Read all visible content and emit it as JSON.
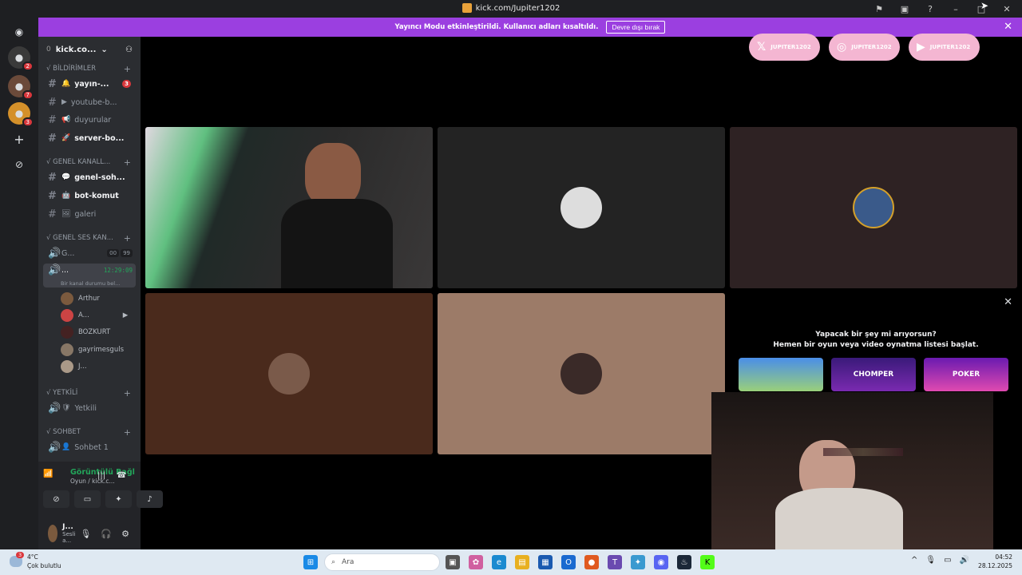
{
  "window": {
    "url_title": "kick.com/Jupiter1202"
  },
  "banner": {
    "text": "Yayıncı Modu etkinleştirildi. Kullanıcı adları kısaltıldı.",
    "button": "Devre dışı bırak"
  },
  "guilds": {
    "badges": [
      "2",
      "7",
      "3"
    ]
  },
  "server": {
    "count": "0",
    "name": "kick.co..."
  },
  "categories": {
    "bildirimler": "√ BİLDİRİMLER",
    "genel_kanallar": "√ GENEL KANALL...",
    "genel_ses": "√ GENEL SES KAN...",
    "yetkili": "√ YETKİLİ",
    "sohbet": "√ SOHBET"
  },
  "channels": {
    "yayin": {
      "label": "yayın-...",
      "badge": "3"
    },
    "youtube": {
      "label": "youtube-b..."
    },
    "duyurular": {
      "label": "duyurular"
    },
    "server_bo": {
      "label": "server-bo..."
    },
    "genel_soh": {
      "label": "genel-soh..."
    },
    "bot_komut": {
      "label": "bot-komut"
    },
    "galeri": {
      "label": "galeri"
    },
    "voice_g": {
      "label": "G...",
      "counter_a": "00",
      "counter_b": "99"
    },
    "voice_active": {
      "label": "...",
      "time": "12:29:09",
      "status": "Bir kanal durumu bel..."
    },
    "yetkili": {
      "label": "Yetkili"
    },
    "sohbet1": {
      "label": "Sohbet 1"
    }
  },
  "voice_users": [
    "Arthur",
    "A...",
    "BOZKURT",
    "gayrimesguls",
    "J..."
  ],
  "voice_panel": {
    "status": "Görüntülü Bağl",
    "sub": "Oyun / kick.c..."
  },
  "user_area": {
    "name": "J...",
    "status": "Sesli a..."
  },
  "socials": [
    "JUPITER1202",
    "JUPITER1202",
    "JUPITER1202"
  ],
  "promo": {
    "line1": "Yapacak bir şey mi arıyorsun?",
    "line2": "Hemen bir oyun veya video oynatma listesi başlat.",
    "cards": [
      "",
      "CHOMPER",
      "POKER"
    ]
  },
  "taskbar": {
    "temp": "4°C",
    "weather": "Çok bulutlu",
    "weather_badge": "3",
    "search": "Ara",
    "time": "04:52",
    "date": "28.12.2025"
  },
  "colors": {
    "accent": "#9b3fe0",
    "online": "#23a55a",
    "badge": "#da373c"
  }
}
